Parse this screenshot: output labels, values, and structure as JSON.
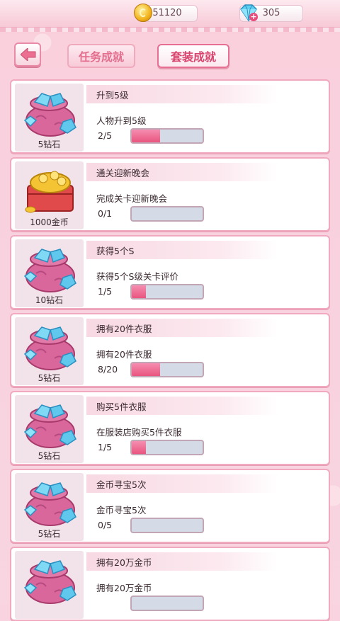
{
  "resources": {
    "coins": "51120",
    "diamonds": "305",
    "icons": {
      "coin": "coin-icon",
      "diamond": "diamond-icon",
      "add": "plus-icon"
    }
  },
  "header": {
    "back_icon": "back-arrow-icon",
    "tabs": [
      {
        "label": "任务成就",
        "active": false
      },
      {
        "label": "套装成就",
        "active": true
      }
    ]
  },
  "colors": {
    "accent": "#e9557f",
    "card_border": "#f1a9bf",
    "bar_empty": "#d5dbe6"
  },
  "achievements": [
    {
      "title": "升到5级",
      "desc": "人物升到5级",
      "progress": "2/5",
      "fraction": 0.4,
      "reward": "5钻石",
      "reward_type": "diamond-bag"
    },
    {
      "title": "通关迎新晚会",
      "desc": "完成关卡迎新晚会",
      "progress": "0/1",
      "fraction": 0,
      "reward": "1000金币",
      "reward_type": "gold-chest"
    },
    {
      "title": "获得5个S",
      "desc": "获得5个S级关卡评价",
      "progress": "1/5",
      "fraction": 0.2,
      "reward": "10钻石",
      "reward_type": "diamond-bag"
    },
    {
      "title": "拥有20件衣服",
      "desc": "拥有20件衣服",
      "progress": "8/20",
      "fraction": 0.4,
      "reward": "5钻石",
      "reward_type": "diamond-bag"
    },
    {
      "title": "购买5件衣服",
      "desc": "在服装店购买5件衣服",
      "progress": "1/5",
      "fraction": 0.2,
      "reward": "5钻石",
      "reward_type": "diamond-bag"
    },
    {
      "title": "金币寻宝5次",
      "desc": "金币寻宝5次",
      "progress": "0/5",
      "fraction": 0,
      "reward": "5钻石",
      "reward_type": "diamond-bag"
    },
    {
      "title": "拥有20万金币",
      "desc": "拥有20万金币",
      "progress": "",
      "fraction": 0,
      "reward": "",
      "reward_type": "diamond-bag"
    }
  ]
}
